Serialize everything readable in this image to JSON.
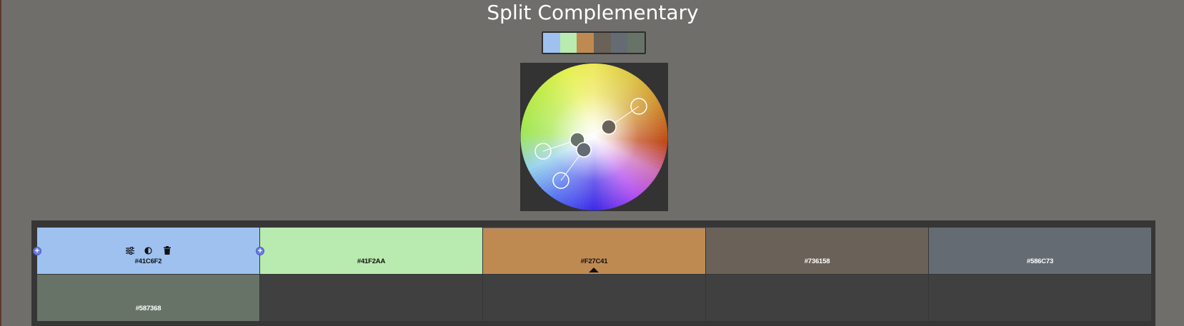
{
  "title": "Split Complementary",
  "palette": [
    {
      "hex": "#41C6F2",
      "display": "#9ec1f0",
      "text": "#111111",
      "label": "#41C6F2"
    },
    {
      "hex": "#41F2AA",
      "display": "#b9eab0",
      "text": "#111111",
      "label": "#41F2AA"
    },
    {
      "hex": "#F27C41",
      "display": "#bf8a52",
      "text": "#111111",
      "label": "#F27C41"
    },
    {
      "hex": "#736158",
      "display": "#6a6158",
      "text": "#ffffff",
      "label": "#736158"
    },
    {
      "hex": "#586C73",
      "display": "#656b72",
      "text": "#ffffff",
      "label": "#586C73"
    },
    {
      "hex": "#587368",
      "display": "#687368",
      "text": "#ffffff",
      "label": "#587368"
    }
  ],
  "wheel": {
    "background": "#333333",
    "line_color": "#ffffff"
  },
  "icons": {
    "adjust": "sliders-icon",
    "contrast": "contrast-icon",
    "delete": "trash-icon",
    "add": "plus-icon"
  }
}
